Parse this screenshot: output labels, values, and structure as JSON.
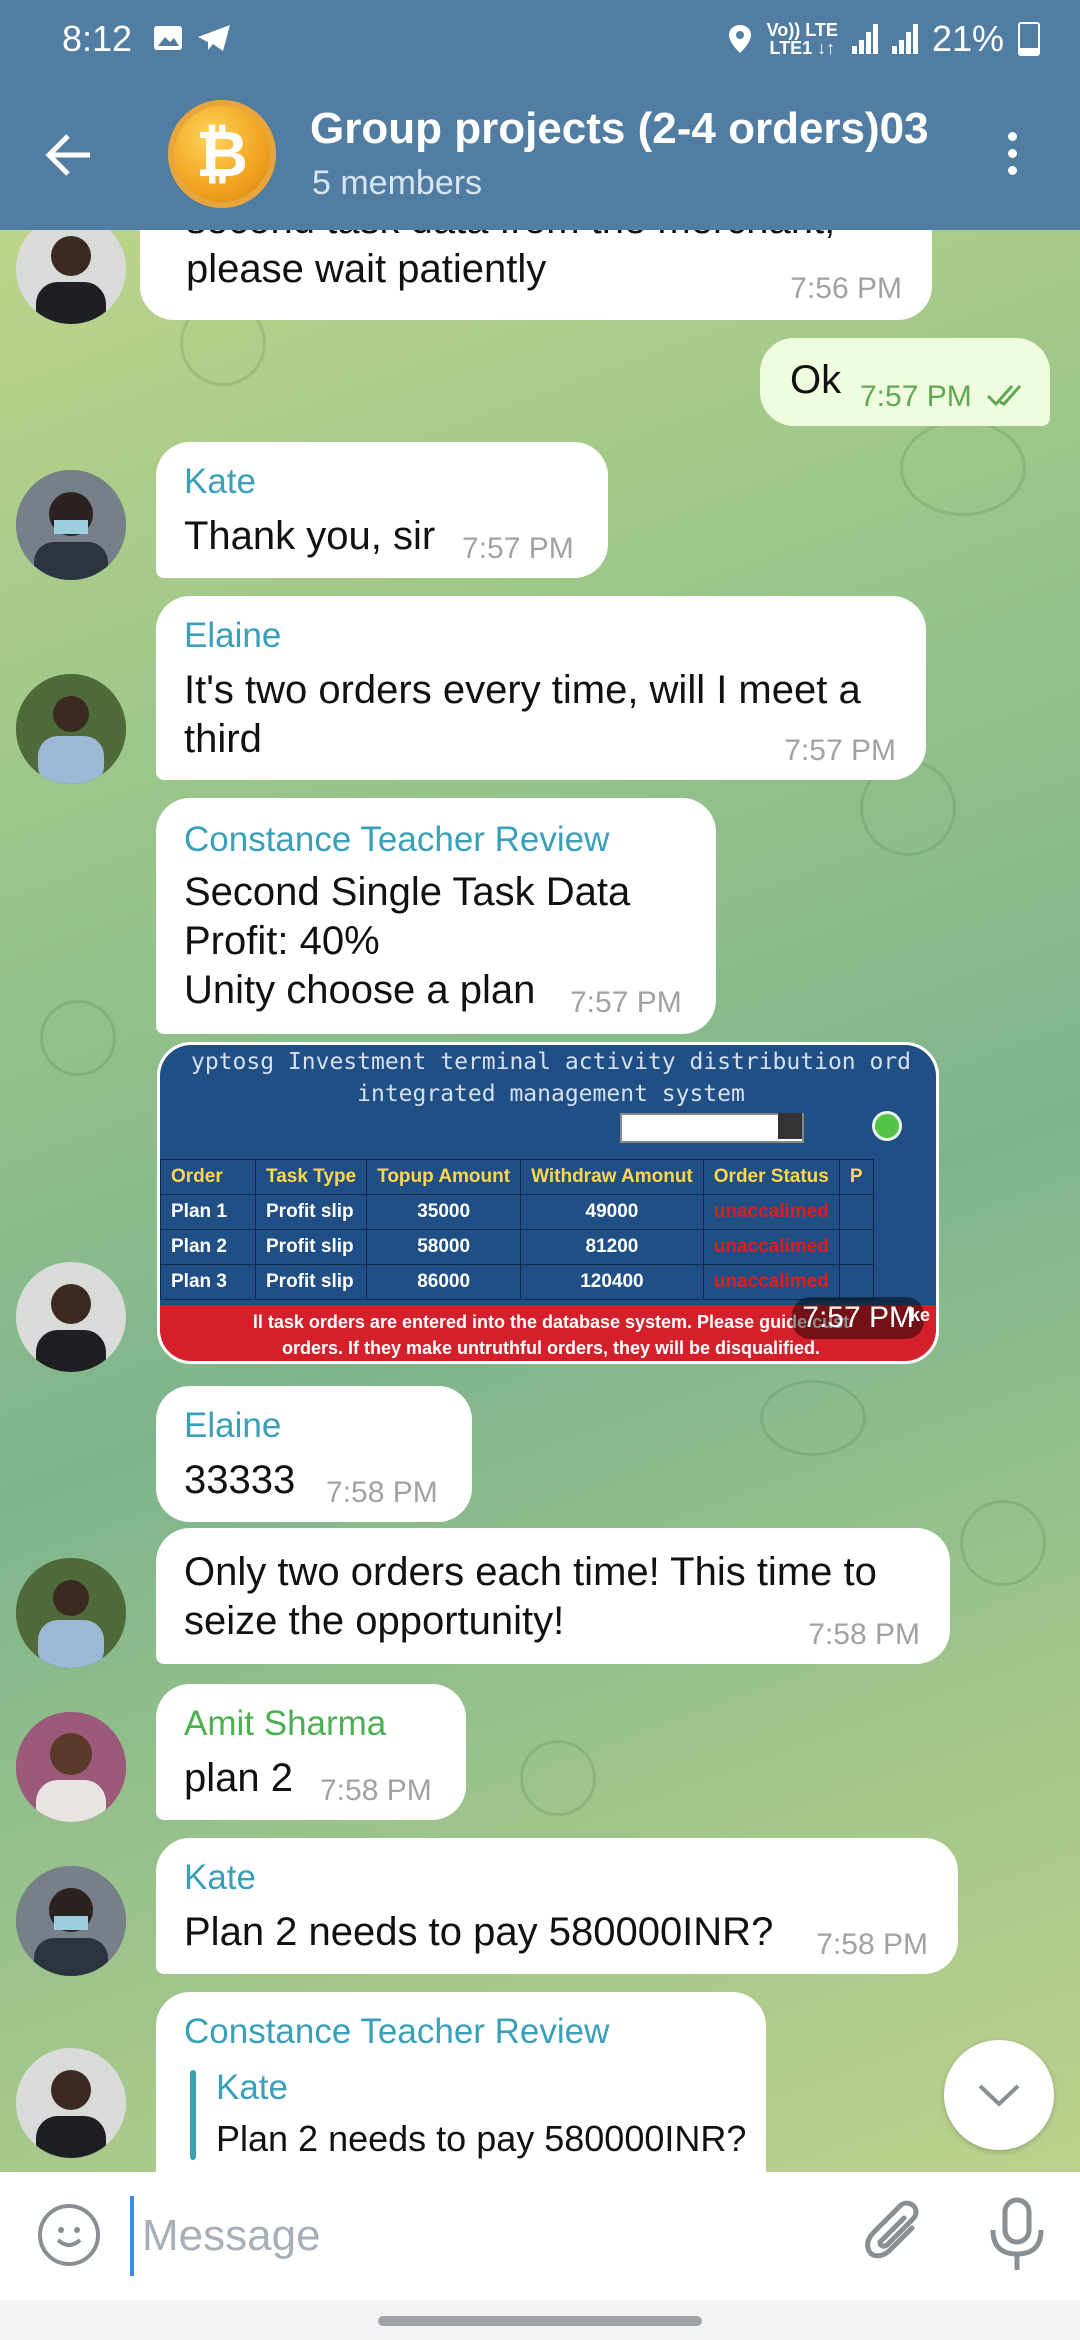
{
  "status_bar": {
    "time": "8:12",
    "net_top": "Vo)) LTE",
    "net_bottom": "LTE1 ↓↑",
    "battery": "21%"
  },
  "header": {
    "title": "Group projects (2-4 orders)03",
    "subtitle": "5 members",
    "avatar_glyph": "₿"
  },
  "messages": [
    {
      "text": "second task data from the merchant,\nplease wait patiently",
      "time": "7:56 PM"
    },
    {
      "text": "Ok",
      "time": "7:57 PM"
    },
    {
      "sender": "Kate",
      "text": "Thank you, sir",
      "time": "7:57 PM"
    },
    {
      "sender": "Elaine",
      "text": "It's two orders every time, will I meet a\nthird",
      "time": "7:57 PM"
    },
    {
      "sender": "Constance Teacher Review",
      "text": "Second Single Task Data\nProfit: 40%\nUnity choose a plan",
      "time": "7:57 PM"
    },
    {
      "time": "7:57 PM"
    },
    {
      "sender": "Elaine",
      "text": "33333",
      "time": "7:58 PM"
    },
    {
      "text": "Only two orders each time! This time to\nseize the opportunity!",
      "time": "7:58 PM"
    },
    {
      "sender": "Amit Sharma",
      "text": "plan 2",
      "time": "7:58 PM"
    },
    {
      "sender": "Kate",
      "text": "Plan 2 needs to pay 580000INR?",
      "time": "7:58 PM"
    },
    {
      "sender": "Constance Teacher Review",
      "reply_sender": "Kate",
      "reply_text": "Plan 2 needs to pay 580000INR?"
    }
  ],
  "photo": {
    "title_line1": "yptosg Investment terminal activity distribution ord",
    "title_line2": "integrated management system",
    "columns": [
      "Order",
      "Task Type",
      "Topup Amount",
      "Withdraw Amonut",
      "Order Status",
      "P"
    ],
    "rows": [
      [
        "Plan 1",
        "Profit slip",
        "35000",
        "49000",
        "unaccalimed"
      ],
      [
        "Plan 2",
        "Profit slip",
        "58000",
        "81200",
        "unaccalimed"
      ],
      [
        "Plan 3",
        "Profit slip",
        "86000",
        "120400",
        "unaccalimed"
      ]
    ],
    "footer_line1": "ll task orders are entered into the database system. Please guide cust",
    "footer_line2": "orders. If they make untruthful orders, they will be disqualified.",
    "footer_tail": "ke"
  },
  "composer": {
    "placeholder": "Message"
  },
  "colors": {
    "header": "#517da2",
    "sender_blue": "#3a9fb8",
    "sender_green": "#4caf50",
    "outgoing": "#effdde"
  },
  "icons": [
    "back-arrow-icon",
    "more-vertical-icon",
    "emoji-icon",
    "attach-icon",
    "mic-icon",
    "chevron-down-icon",
    "double-check-icon"
  ]
}
